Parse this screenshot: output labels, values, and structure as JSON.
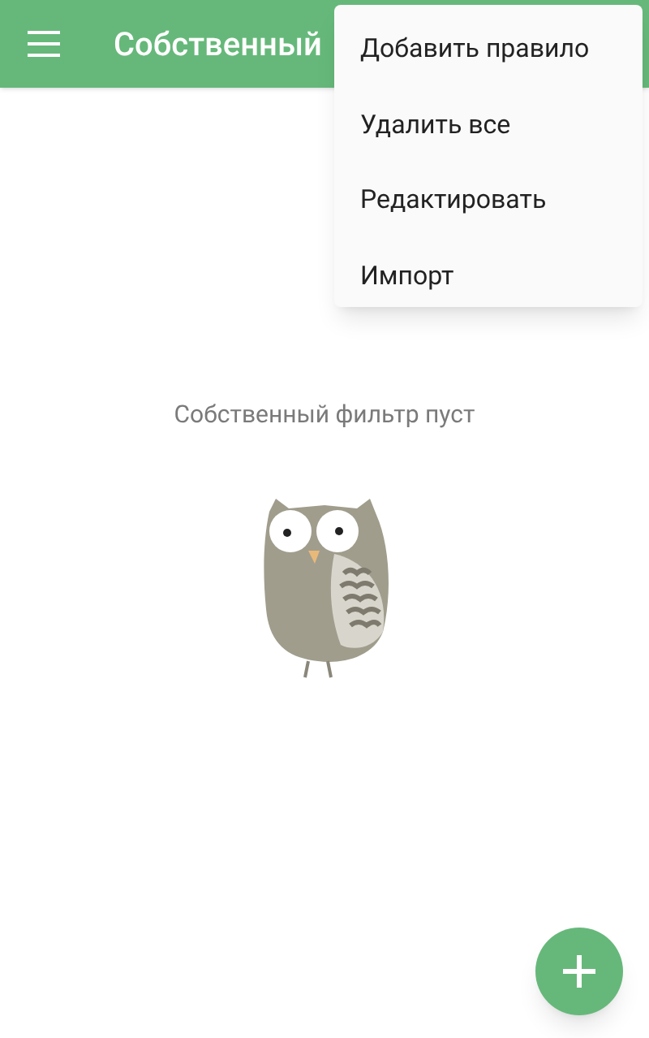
{
  "app_bar": {
    "title": "Собственный"
  },
  "menu": {
    "items": [
      {
        "label": "Добавить правило"
      },
      {
        "label": "Удалить все"
      },
      {
        "label": "Редактировать"
      },
      {
        "label": "Импорт"
      }
    ]
  },
  "empty_state": {
    "message": "Собственный фильтр пуст"
  }
}
